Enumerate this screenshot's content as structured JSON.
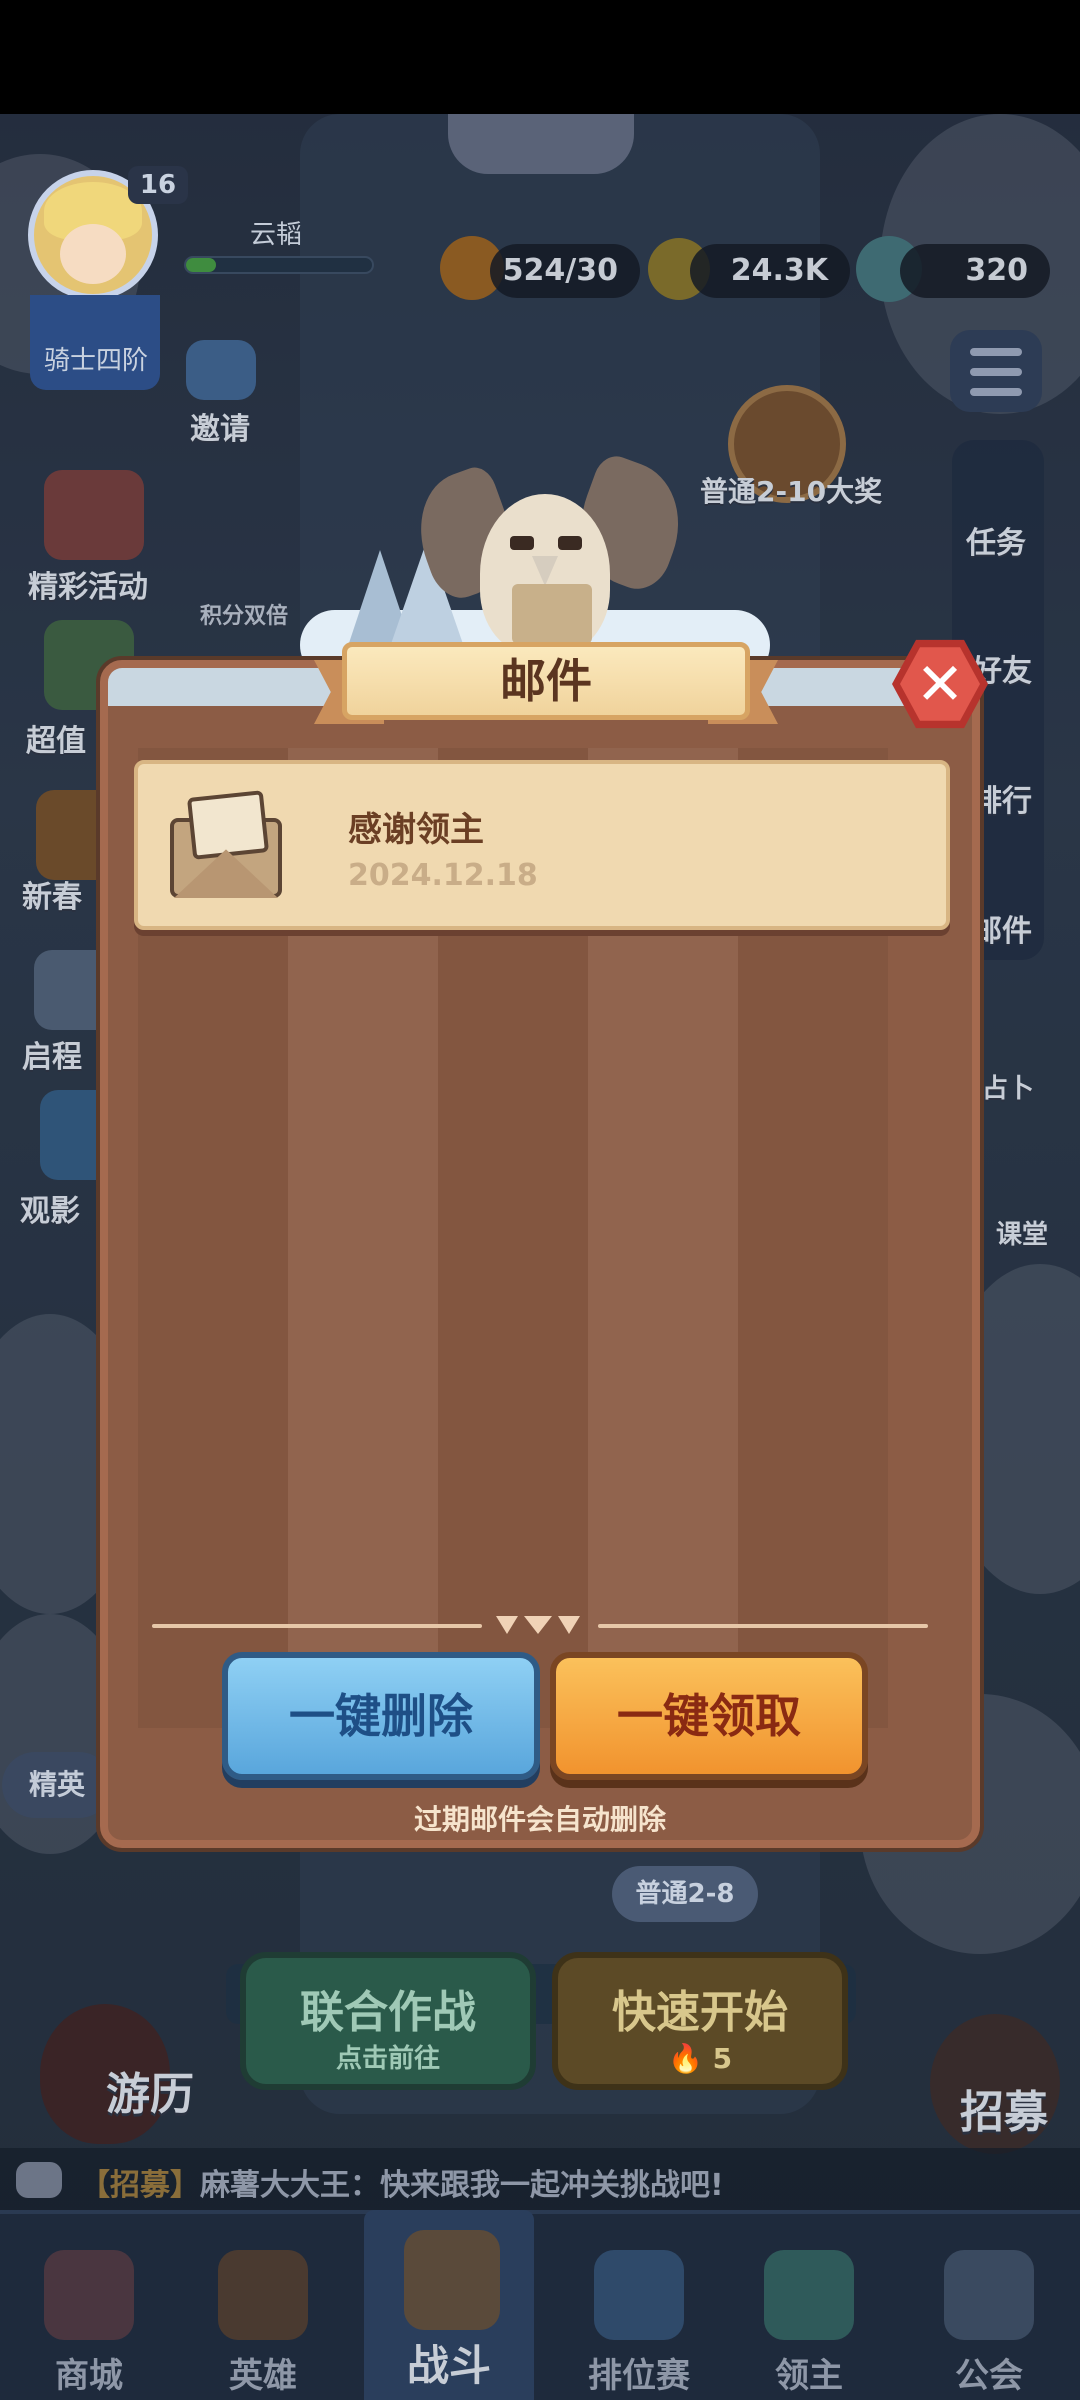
{
  "player": {
    "level": "16",
    "name": "云韬",
    "rank": "骑士四阶",
    "exp_progress": 0.16
  },
  "resources": {
    "stamina": "524/30",
    "gold": "24.3K",
    "gems": "320"
  },
  "left_menu": {
    "invite": "邀请",
    "events": "精彩活动",
    "points_double": "积分双倍",
    "super_value": "超值",
    "spring": "新春",
    "journey": "启程",
    "viewing": "观影",
    "elite": "精英"
  },
  "right_menu": {
    "stage_reward": "普通2-10大奖",
    "tasks": "任务",
    "friends": "好友",
    "rank": "排行",
    "mail": "邮件",
    "fortune": "占卜",
    "class": "课堂"
  },
  "battle": {
    "stage": "普通2-8",
    "coop_title": "联合作战",
    "coop_sub": "点击前往",
    "quick_title": "快速开始",
    "quick_cost": "5",
    "travel": "游历",
    "recruit": "招募"
  },
  "chat": {
    "tag": "【招募】",
    "message": "麻薯大大王：快来跟我一起冲关挑战吧!"
  },
  "bottom_nav": [
    {
      "label": "商城"
    },
    {
      "label": "英雄"
    },
    {
      "label": "战斗"
    },
    {
      "label": "排位赛"
    },
    {
      "label": "领主"
    },
    {
      "label": "公会"
    }
  ],
  "mail_dialog": {
    "title": "邮件",
    "items": [
      {
        "title": "感谢领主",
        "date": "2024.12.18"
      }
    ],
    "delete_all": "一键删除",
    "claim_all": "一键领取",
    "footer_note": "过期邮件会自动删除"
  },
  "colors": {
    "dialog_bg": "#8c5c45",
    "delete_button": "#59a6dc",
    "claim_button": "#f1932e",
    "close_button": "#e1574c"
  }
}
